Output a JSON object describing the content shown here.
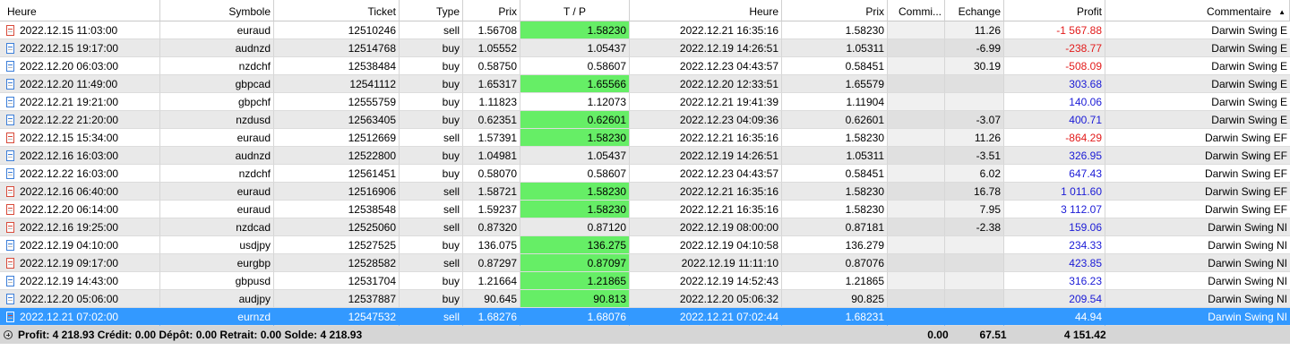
{
  "headers": [
    "Heure",
    "Symbole",
    "Ticket",
    "Type",
    "Prix",
    "T / P",
    "Heure",
    "Prix",
    "Commi...",
    "Echange",
    "Profit",
    "Commentaire"
  ],
  "rows": [
    [
      "2022.12.15 11:03:00",
      "euraud",
      "12510246",
      "sell",
      "1.56708",
      "1.58230",
      "2022.12.21 16:35:16",
      "1.58230",
      "",
      "11.26",
      "-1 567.88",
      "Darwin Swing E"
    ],
    [
      "2022.12.15 19:17:00",
      "audnzd",
      "12514768",
      "buy",
      "1.05552",
      "1.05437",
      "2022.12.19 14:26:51",
      "1.05311",
      "",
      "-6.99",
      "-238.77",
      "Darwin Swing E"
    ],
    [
      "2022.12.20 06:03:00",
      "nzdchf",
      "12538484",
      "buy",
      "0.58750",
      "0.58607",
      "2022.12.23 04:43:57",
      "0.58451",
      "",
      "30.19",
      "-508.09",
      "Darwin Swing E"
    ],
    [
      "2022.12.20 11:49:00",
      "gbpcad",
      "12541112",
      "buy",
      "1.65317",
      "1.65566",
      "2022.12.20 12:33:51",
      "1.65579",
      "",
      "",
      "303.68",
      "Darwin Swing E"
    ],
    [
      "2022.12.21 19:21:00",
      "gbpchf",
      "12555759",
      "buy",
      "1.11823",
      "1.12073",
      "2022.12.21 19:41:39",
      "1.11904",
      "",
      "",
      "140.06",
      "Darwin Swing E"
    ],
    [
      "2022.12.22 21:20:00",
      "nzdusd",
      "12563405",
      "buy",
      "0.62351",
      "0.62601",
      "2022.12.23 04:09:36",
      "0.62601",
      "",
      "-3.07",
      "400.71",
      "Darwin Swing E"
    ],
    [
      "2022.12.15 15:34:00",
      "euraud",
      "12512669",
      "sell",
      "1.57391",
      "1.58230",
      "2022.12.21 16:35:16",
      "1.58230",
      "",
      "11.26",
      "-864.29",
      "Darwin Swing EF"
    ],
    [
      "2022.12.16 16:03:00",
      "audnzd",
      "12522800",
      "buy",
      "1.04981",
      "1.05437",
      "2022.12.19 14:26:51",
      "1.05311",
      "",
      "-3.51",
      "326.95",
      "Darwin Swing EF"
    ],
    [
      "2022.12.22 16:03:00",
      "nzdchf",
      "12561451",
      "buy",
      "0.58070",
      "0.58607",
      "2022.12.23 04:43:57",
      "0.58451",
      "",
      "6.02",
      "647.43",
      "Darwin Swing EF"
    ],
    [
      "2022.12.16 06:40:00",
      "euraud",
      "12516906",
      "sell",
      "1.58721",
      "1.58230",
      "2022.12.21 16:35:16",
      "1.58230",
      "",
      "16.78",
      "1 011.60",
      "Darwin Swing EF"
    ],
    [
      "2022.12.20 06:14:00",
      "euraud",
      "12538548",
      "sell",
      "1.59237",
      "1.58230",
      "2022.12.21 16:35:16",
      "1.58230",
      "",
      "7.95",
      "3 112.07",
      "Darwin Swing EF"
    ],
    [
      "2022.12.16 19:25:00",
      "nzdcad",
      "12525060",
      "sell",
      "0.87320",
      "0.87120",
      "2022.12.19 08:00:00",
      "0.87181",
      "",
      "-2.38",
      "159.06",
      "Darwin Swing NI"
    ],
    [
      "2022.12.19 04:10:00",
      "usdjpy",
      "12527525",
      "buy",
      "136.075",
      "136.275",
      "2022.12.19 04:10:58",
      "136.279",
      "",
      "",
      "234.33",
      "Darwin Swing NI"
    ],
    [
      "2022.12.19 09:17:00",
      "eurgbp",
      "12528582",
      "sell",
      "0.87297",
      "0.87097",
      "2022.12.19 11:11:10",
      "0.87076",
      "",
      "",
      "423.85",
      "Darwin Swing NI"
    ],
    [
      "2022.12.19 14:43:00",
      "gbpusd",
      "12531704",
      "buy",
      "1.21664",
      "1.21865",
      "2022.12.19 14:52:43",
      "1.21865",
      "",
      "",
      "316.23",
      "Darwin Swing NI"
    ],
    [
      "2022.12.20 05:06:00",
      "audjpy",
      "12537887",
      "buy",
      "90.645",
      "90.813",
      "2022.12.20 05:06:32",
      "90.825",
      "",
      "",
      "209.54",
      "Darwin Swing NI"
    ],
    [
      "2022.12.21 07:02:00",
      "eurnzd",
      "12547532",
      "sell",
      "1.68276",
      "1.68076",
      "2022.12.21 07:02:44",
      "1.68231",
      "",
      "",
      "44.94",
      "Darwin Swing NI"
    ]
  ],
  "tp_highlight": [
    true,
    false,
    false,
    true,
    false,
    true,
    true,
    false,
    false,
    true,
    true,
    false,
    true,
    true,
    true,
    true,
    false
  ],
  "selected_row": 16,
  "summary": {
    "text": "Profit: 4 218.93  Crédit: 0.00  Dépôt: 0.00  Retrait: 0.00  Solde: 4 218.93",
    "commission": "0.00",
    "swap": "67.51",
    "profit": "4 151.42"
  },
  "colors": {
    "tp_hit": "#66ee66",
    "selected": "#3399ff",
    "negative": "#e21a1a",
    "positive": "#1a1ad6"
  }
}
